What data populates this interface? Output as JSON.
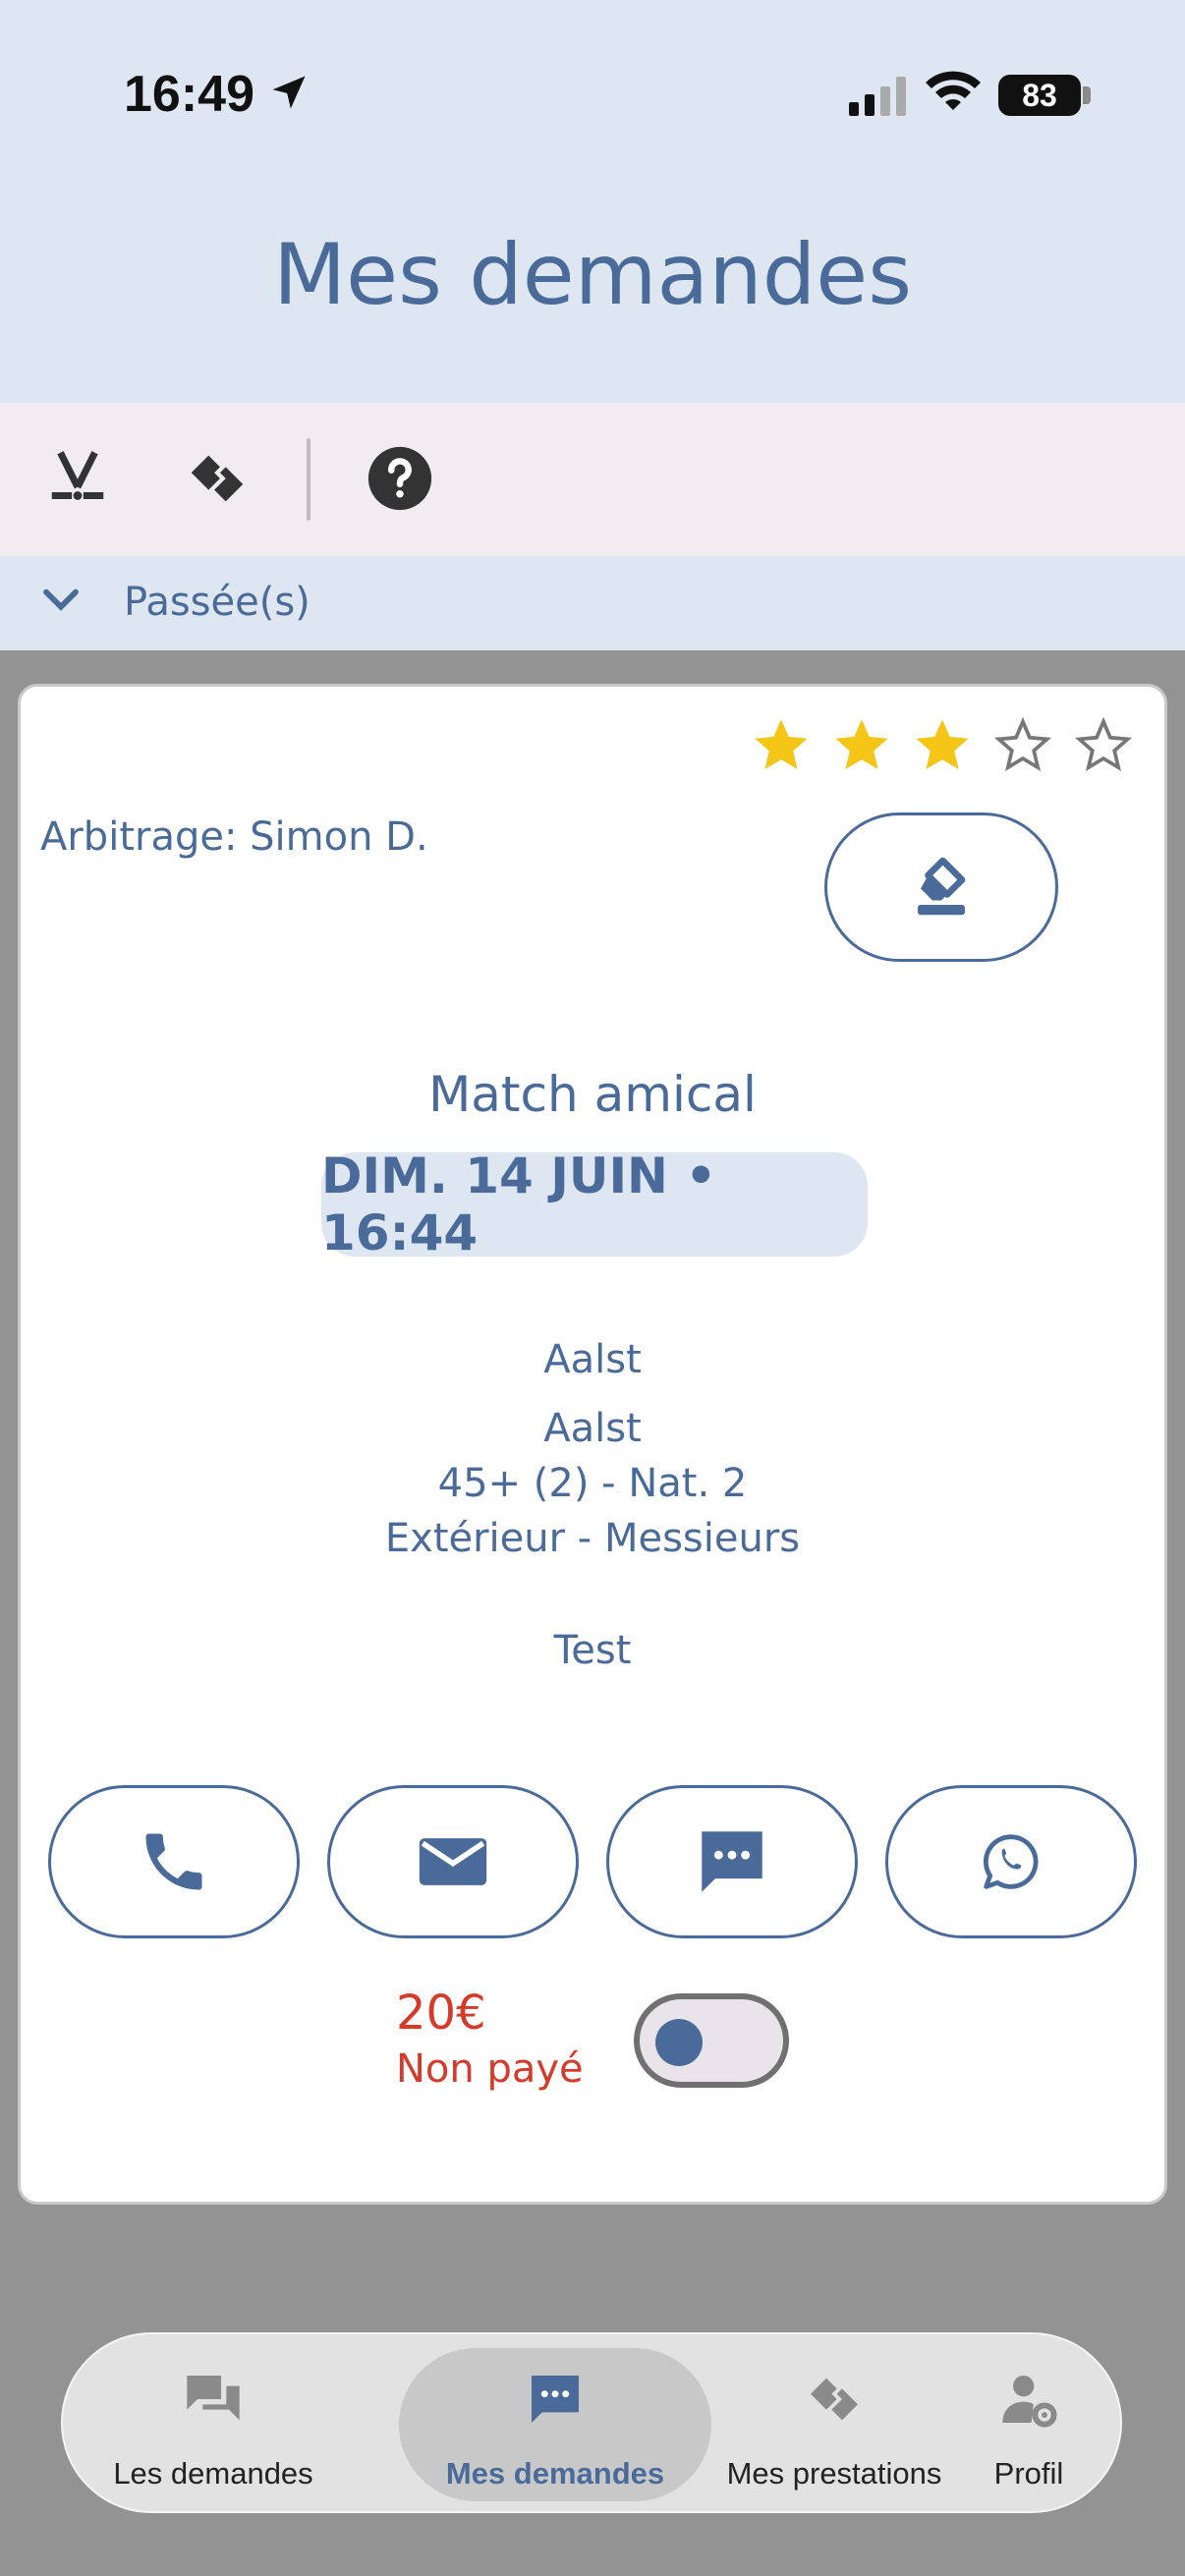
{
  "status_bar": {
    "time": "16:49",
    "battery": "83"
  },
  "header": {
    "title": "Mes demandes"
  },
  "section": {
    "label": "Passée(s)"
  },
  "card": {
    "rating": 3,
    "rating_max": 5,
    "referee": "Arbitrage: Simon D.",
    "match_type": "Match amical",
    "date": "DIM. 14 JUIN • 16:44",
    "location_1": "Aalst",
    "location_2": "Aalst",
    "category": "45+ (2) - Nat. 2",
    "side": "Extérieur - Messieurs",
    "note": "Test",
    "price": "20€",
    "payment_status": "Non payé",
    "paid": false
  },
  "contacts": [
    "phone-icon",
    "mail-icon",
    "sms-icon",
    "whatsapp-icon"
  ],
  "tabs": [
    {
      "label": "Les demandes",
      "icon": "chat-icon",
      "active": false
    },
    {
      "label": "Mes demandes",
      "icon": "message-icon",
      "active": true
    },
    {
      "label": "Mes prestations",
      "icon": "handshake-icon",
      "active": false
    },
    {
      "label": "Profil",
      "icon": "user-gear-icon",
      "active": false
    }
  ],
  "colors": {
    "accent": "#4a6b9a",
    "header_bg": "#dde6f1",
    "star": "#f5c518",
    "unpaid": "#d63a2a"
  }
}
